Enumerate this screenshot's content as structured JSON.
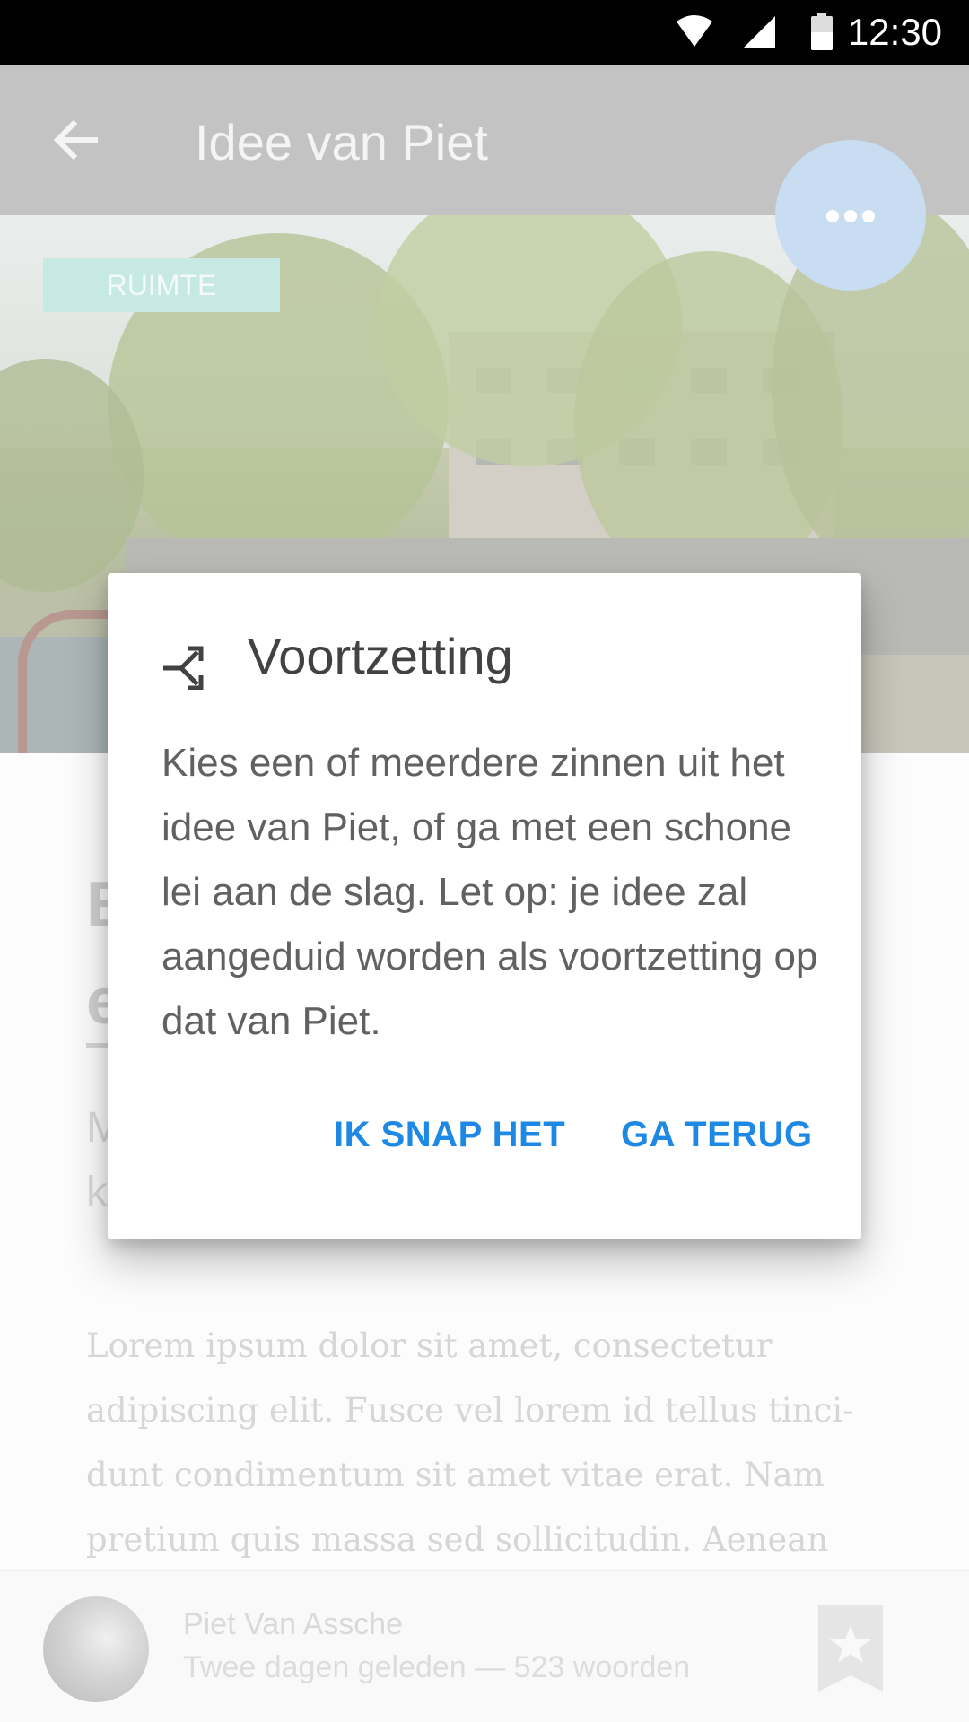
{
  "status_bar": {
    "time": "12:30"
  },
  "app_bar": {
    "title": "Idee van Piet"
  },
  "hero": {
    "tag": "RUIMTE"
  },
  "article": {
    "title": "B\ne",
    "subtitle": "M\nk",
    "body": "Lorem ipsum dolor sit amet, consectetur adipiscing elit. Fusce vel lorem id tellus tinci-dunt condimentum sit amet vitae erat. Nam pretium quis massa sed sollicitudin. Aenean"
  },
  "footer": {
    "author": "Piet Van Assche",
    "meta": "Twee dagen geleden — 523 woorden"
  },
  "dialog": {
    "title": "Voortzetting",
    "text": "Kies een of meerdere zinnen uit het idee van Piet, of ga met een schone lei aan de slag. Let op: je idee zal aangeduid worden als voortzetting op dat van Piet.",
    "confirm_label": "IK SNAP HET",
    "back_label": "GA TERUG"
  },
  "icons": {
    "back": "arrow-left-icon",
    "more": "more-horizontal-icon",
    "merge": "merge-icon",
    "bookmark": "bookmark-star-icon",
    "wifi": "wifi-icon",
    "signal": "signal-icon",
    "battery": "battery-icon"
  },
  "colors": {
    "accent": "#1e88e5",
    "tag": "#a3dcd2",
    "fab": "#a7c9e8",
    "appbar": "#9e9e9e"
  }
}
